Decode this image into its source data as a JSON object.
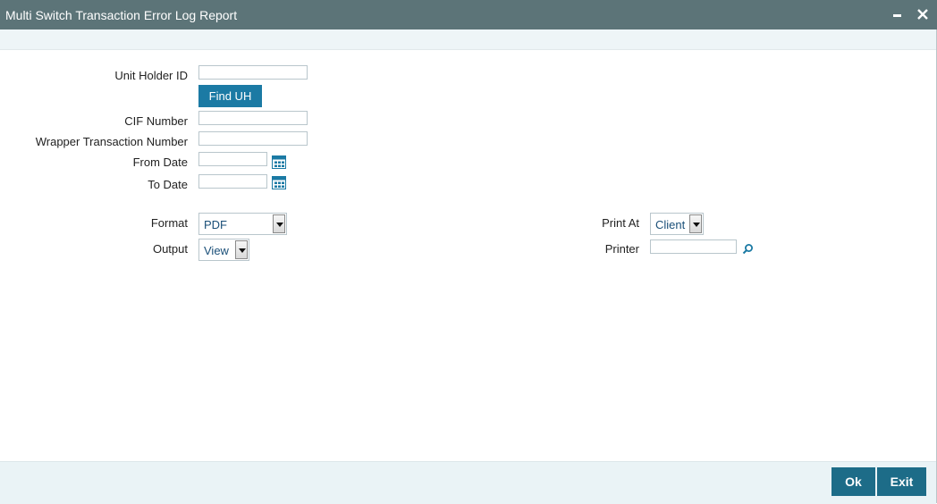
{
  "window": {
    "title": "Multi Switch Transaction Error Log Report"
  },
  "form": {
    "unit_holder_id": {
      "label": "Unit Holder ID",
      "value": ""
    },
    "find_uh_button": "Find UH",
    "cif_number": {
      "label": "CIF Number",
      "value": ""
    },
    "wrapper_transaction_number": {
      "label": "Wrapper Transaction Number",
      "value": ""
    },
    "from_date": {
      "label": "From Date",
      "value": ""
    },
    "to_date": {
      "label": "To Date",
      "value": ""
    },
    "format": {
      "label": "Format",
      "value": "PDF"
    },
    "output": {
      "label": "Output",
      "value": "View"
    },
    "print_at": {
      "label": "Print At",
      "value": "Client"
    },
    "printer": {
      "label": "Printer",
      "value": ""
    }
  },
  "footer": {
    "ok_label": "Ok",
    "exit_label": "Exit"
  },
  "colors": {
    "title_bar": "#5c7478",
    "button": "#1b7aa4",
    "footer_button": "#1d6c88"
  },
  "icons": [
    "minimize-icon",
    "close-icon",
    "calendar-icon",
    "search-icon",
    "chevron-down-icon"
  ]
}
